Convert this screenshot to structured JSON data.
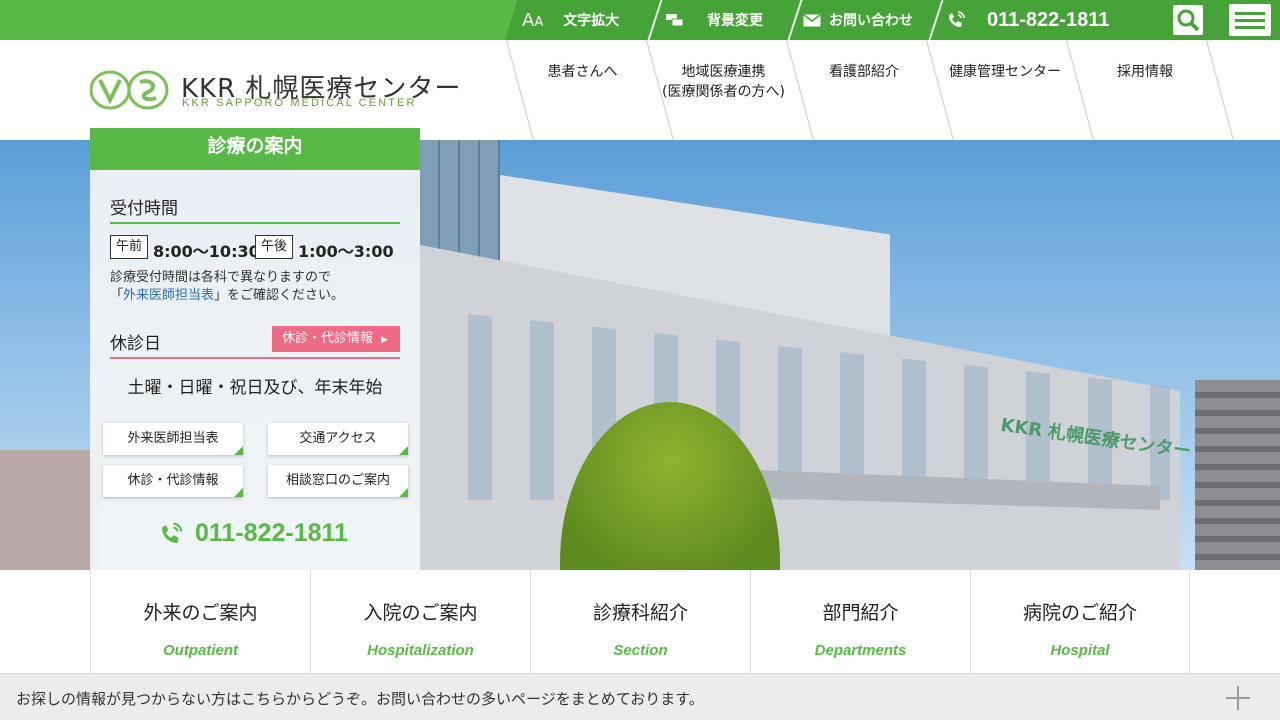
{
  "topbar": {
    "font_size_label_big": "A",
    "font_size_label_small": "A",
    "font_size_label": "文字拡大",
    "bg_change_label": "背景変更",
    "contact_label": "お問い合わせ",
    "phone": "011-822-1811"
  },
  "brand": {
    "name": "KKR 札幌医療センター",
    "name_en": "KKR SAPPORO MEDICAL CENTER"
  },
  "nav": {
    "items": [
      {
        "label": "患者さんへ"
      },
      {
        "label": "地域医療連携",
        "sub": "(医療関係者の方へ)"
      },
      {
        "label": "看護部紹介"
      },
      {
        "label": "健康管理センター"
      },
      {
        "label": "採用情報"
      }
    ]
  },
  "panel": {
    "title": "診療の案内",
    "reception_title": "受付時間",
    "am_tag": "午前",
    "am_time": "8:00〜10:30",
    "pm_tag": "午後",
    "pm_time": "1:00〜3:00",
    "note_line1": "診療受付時間は各科で異なりますので",
    "note_open": "「",
    "note_link": "外来医師担当表",
    "note_close": "」をご確認ください。",
    "closed_title": "休診日",
    "closed_button": "休診・代診情報",
    "closed_days": "土曜・日曜・祝日及び、年末年始",
    "buttons": [
      "外来医師担当表",
      "交通アクセス",
      "休診・代診情報",
      "相談窓口のご案内"
    ],
    "phone": "011-822-1811"
  },
  "categories": [
    {
      "jp": "外来のご案内",
      "en": "Outpatient"
    },
    {
      "jp": "入院のご案内",
      "en": "Hospitalization"
    },
    {
      "jp": "診療科紹介",
      "en": "Section"
    },
    {
      "jp": "部門紹介",
      "en": "Departments"
    },
    {
      "jp": "病院のご紹介",
      "en": "Hospital"
    }
  ],
  "footer_bar": {
    "text": "お探しの情報が見つからない方はこちらからどうぞ。お問い合わせの多いページをまとめております。"
  },
  "hero": {
    "building_sign": "KKR 札幌医療センター"
  },
  "colors": {
    "green": "#58b947",
    "dark_green": "#45a338",
    "pink": "#ee6b83",
    "link": "#2a6fb8"
  }
}
